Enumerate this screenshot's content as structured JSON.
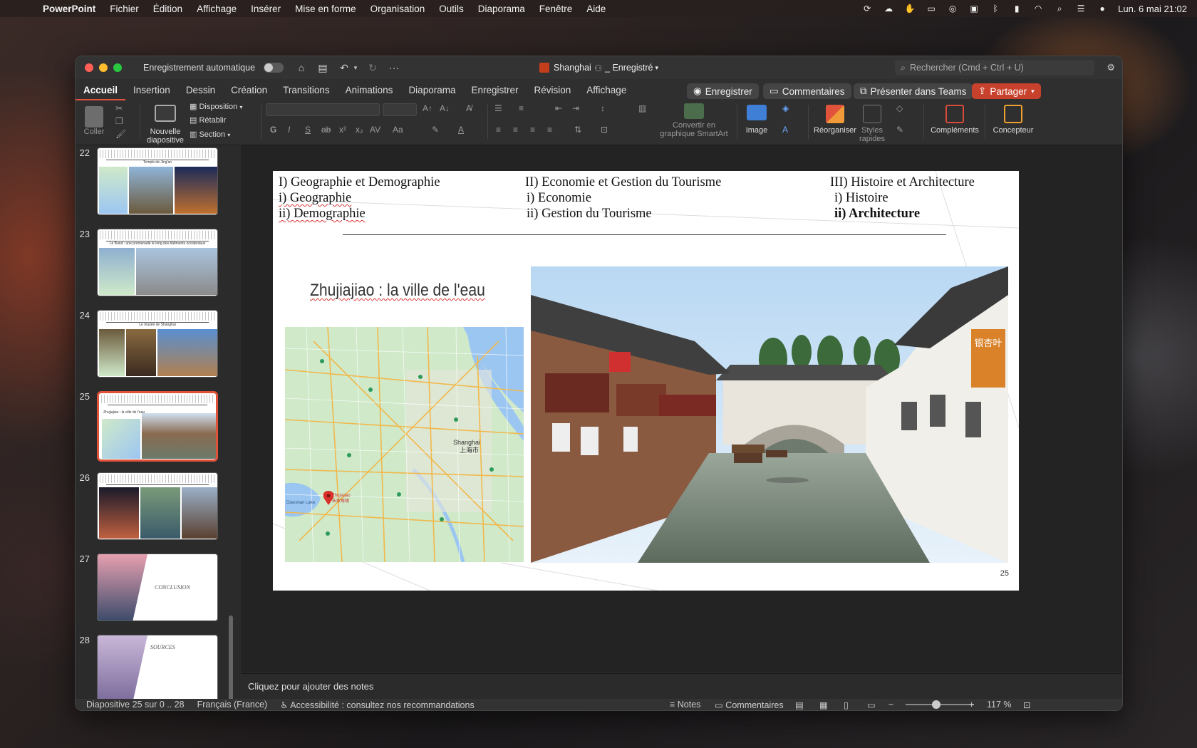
{
  "menubar": {
    "app": "PowerPoint",
    "items": [
      "Fichier",
      "Édition",
      "Affichage",
      "Insérer",
      "Mise en forme",
      "Organisation",
      "Outils",
      "Diaporama",
      "Fenêtre",
      "Aide"
    ],
    "clock": "Lun. 6 mai  21:02"
  },
  "window": {
    "autosave_label": "Enregistrement automatique",
    "doc_title": "Shanghai",
    "doc_status": "_ Enregistré",
    "search_placeholder": "Rechercher (Cmd + Ctrl + U)"
  },
  "tabs": [
    "Accueil",
    "Insertion",
    "Dessin",
    "Création",
    "Transitions",
    "Animations",
    "Diaporama",
    "Enregistrer",
    "Révision",
    "Affichage"
  ],
  "tab_buttons": {
    "record": "Enregistrer",
    "comments": "Commentaires",
    "teams": "Présenter dans Teams",
    "share": "Partager"
  },
  "ribbon": {
    "paste": "Coller",
    "new_slide_1": "Nouvelle",
    "new_slide_2": "diapositive",
    "layout": "Disposition",
    "reset": "Rétablir",
    "section": "Section",
    "smartart_1": "Convertir en",
    "smartart_2": "graphique SmartArt",
    "image": "Image",
    "arrange": "Réorganiser",
    "quick_styles_1": "Styles",
    "quick_styles_2": "rapides",
    "addins": "Compléments",
    "designer": "Concepteur"
  },
  "thumbnails": [
    {
      "num": "22",
      "caption": "Temple de Jing'an"
    },
    {
      "num": "23",
      "caption": "Le Bund : une promenade le long des bâtiments occidentaux"
    },
    {
      "num": "24",
      "caption": "Le musée de Shanghai"
    },
    {
      "num": "25",
      "caption": "Zhujiajiao : la ville de l'eau"
    },
    {
      "num": "26",
      "caption": ""
    },
    {
      "num": "27",
      "caption": "CONCLUSION"
    },
    {
      "num": "28",
      "caption": "SOURCES"
    }
  ],
  "slide": {
    "col1": [
      "I) Geographie et Demographie",
      "i) Geographie",
      "ii) Demographie"
    ],
    "col2": [
      "II) Economie et Gestion du Tourisme",
      "i) Economie",
      "ii) Gestion du Tourisme"
    ],
    "col3": [
      "III) Histoire et Architecture",
      "i) Histoire",
      "ii) Architecture"
    ],
    "title": "Zhujiajiao : la ville de l'eau",
    "page_number": "25",
    "map_labels": {
      "shanghai_en": "Shanghai",
      "shanghai_cn": "上海市",
      "pin_en": "Zhujiajiao",
      "pin_cn": "朱家角镇",
      "lake": "Dianshan Lake"
    },
    "shop_sign": "银杏叶"
  },
  "notes_placeholder": "Cliquez pour ajouter des notes",
  "statusbar": {
    "slide_count": "Diapositive 25 sur 0 .. 28",
    "language": "Français (France)",
    "accessibility": "Accessibilité : consultez nos recommandations",
    "notes": "Notes",
    "comments": "Commentaires",
    "zoom": "117 %"
  },
  "colors": {
    "accent": "#e0533a",
    "share": "#c8412d",
    "map_land": "#cfe9c9",
    "map_water": "#9cc6f2",
    "map_road": "#f2b84b"
  }
}
